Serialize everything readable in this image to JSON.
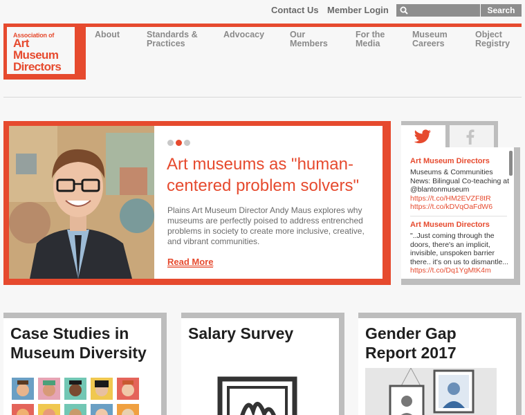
{
  "utility": {
    "contact": "Contact Us",
    "login": "Member Login",
    "search_placeholder": "",
    "search_button": "Search"
  },
  "logo": {
    "line1": "Association of",
    "line2": "Art",
    "line3": "Museum",
    "line4": "Directors"
  },
  "nav": [
    {
      "line1": "About",
      "line2": ""
    },
    {
      "line1": "Standards &",
      "line2": "Practices"
    },
    {
      "line1": "Advocacy",
      "line2": ""
    },
    {
      "line1": "Our",
      "line2": "Members"
    },
    {
      "line1": "For the",
      "line2": "Media"
    },
    {
      "line1": "Museum",
      "line2": "Careers"
    },
    {
      "line1": "Object",
      "line2": "Registry"
    }
  ],
  "hero": {
    "title": "Art museums as \"human-centered problem solvers\"",
    "text": "Plains Art Museum Director Andy Maus explores why museums are perfectly poised to address entrenched problems in society to create more inclusive, creative, and vibrant communities.",
    "read_more": "Read More",
    "active_slide": 2,
    "slide_count": 3
  },
  "social": {
    "tabs": [
      {
        "icon": "twitter-icon"
      },
      {
        "icon": "facebook-icon"
      }
    ],
    "tweets": [
      {
        "author": "Art Museum Directors",
        "text": "Museums & Communities News: Bilingual Co-teaching at @blantonmuseum",
        "links": [
          "https://t.co/HM2EVZF8tR",
          "https://t.co/kDVqOaFdW6"
        ]
      },
      {
        "author": "Art Museum Directors",
        "text": "\"..Just coming through the doors, there's an implicit, invisible, unspoken barrier there.. it's on us to dismantle...",
        "links": [
          "https://t.co/Dq1YgMtK4m"
        ]
      }
    ]
  },
  "cards": [
    {
      "title_line1": "Case Studies in",
      "title_line2": "Museum Diversity"
    },
    {
      "title_line1": "Salary Survey",
      "title_line2": ""
    },
    {
      "title_line1": "Gender Gap",
      "title_line2": "Report 2017"
    }
  ],
  "colors": {
    "accent": "#e64a2e",
    "gray_frame": "#bdbdbd",
    "nav_text": "#8a8a8a"
  }
}
